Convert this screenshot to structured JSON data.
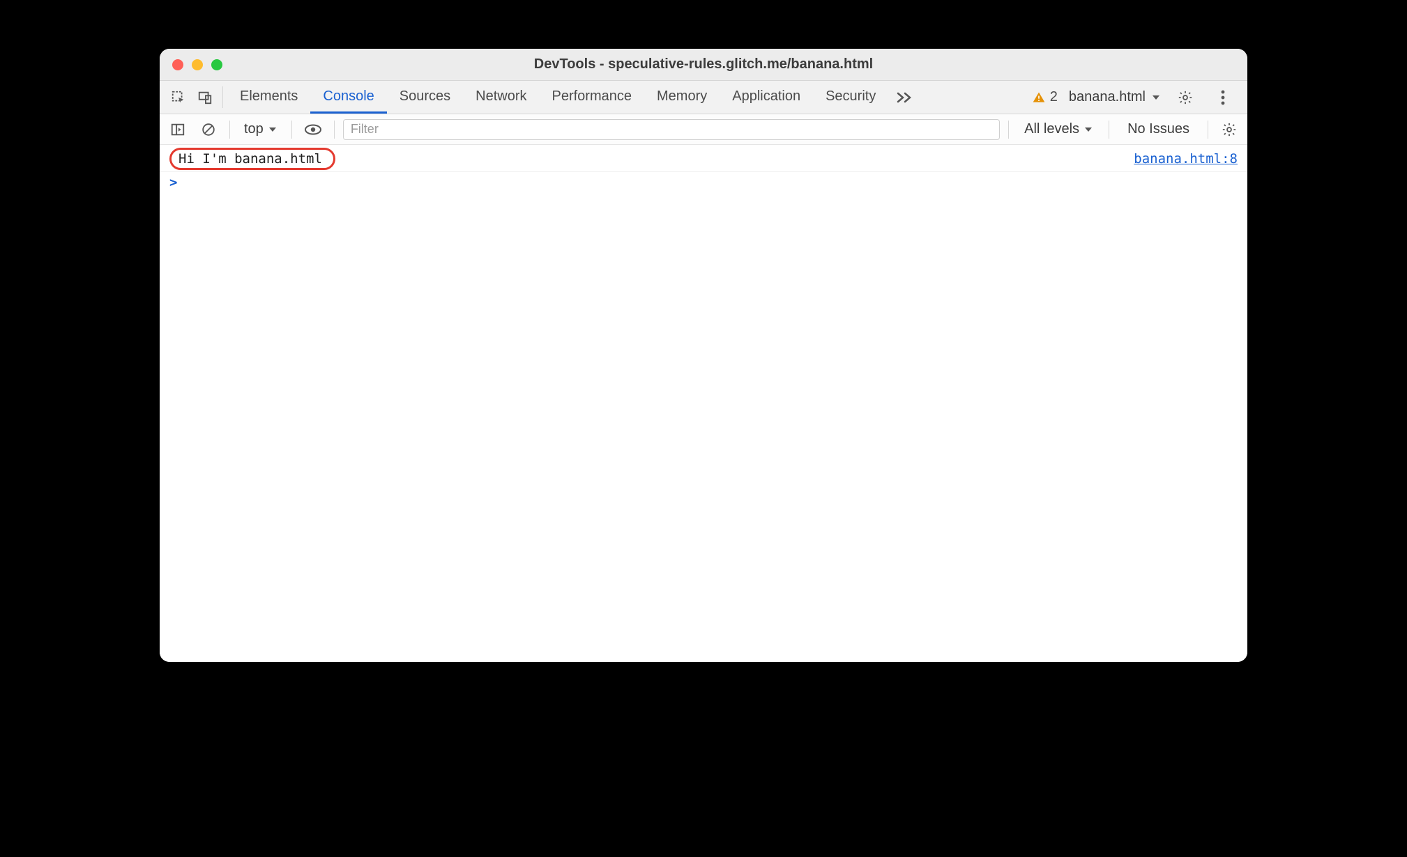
{
  "window": {
    "title": "DevTools - speculative-rules.glitch.me/banana.html"
  },
  "tabs": {
    "items": [
      "Elements",
      "Console",
      "Sources",
      "Network",
      "Performance",
      "Memory",
      "Application",
      "Security"
    ],
    "active_index": 1
  },
  "toolbar": {
    "warning_count": "2",
    "frame_label": "banana.html"
  },
  "filterbar": {
    "context_label": "top",
    "filter_placeholder": "Filter",
    "levels_label": "All levels",
    "issues_label": "No Issues"
  },
  "console": {
    "logs": [
      {
        "message": "Hi I'm banana.html",
        "source": "banana.html:8",
        "highlighted": true
      }
    ],
    "prompt": ">"
  }
}
